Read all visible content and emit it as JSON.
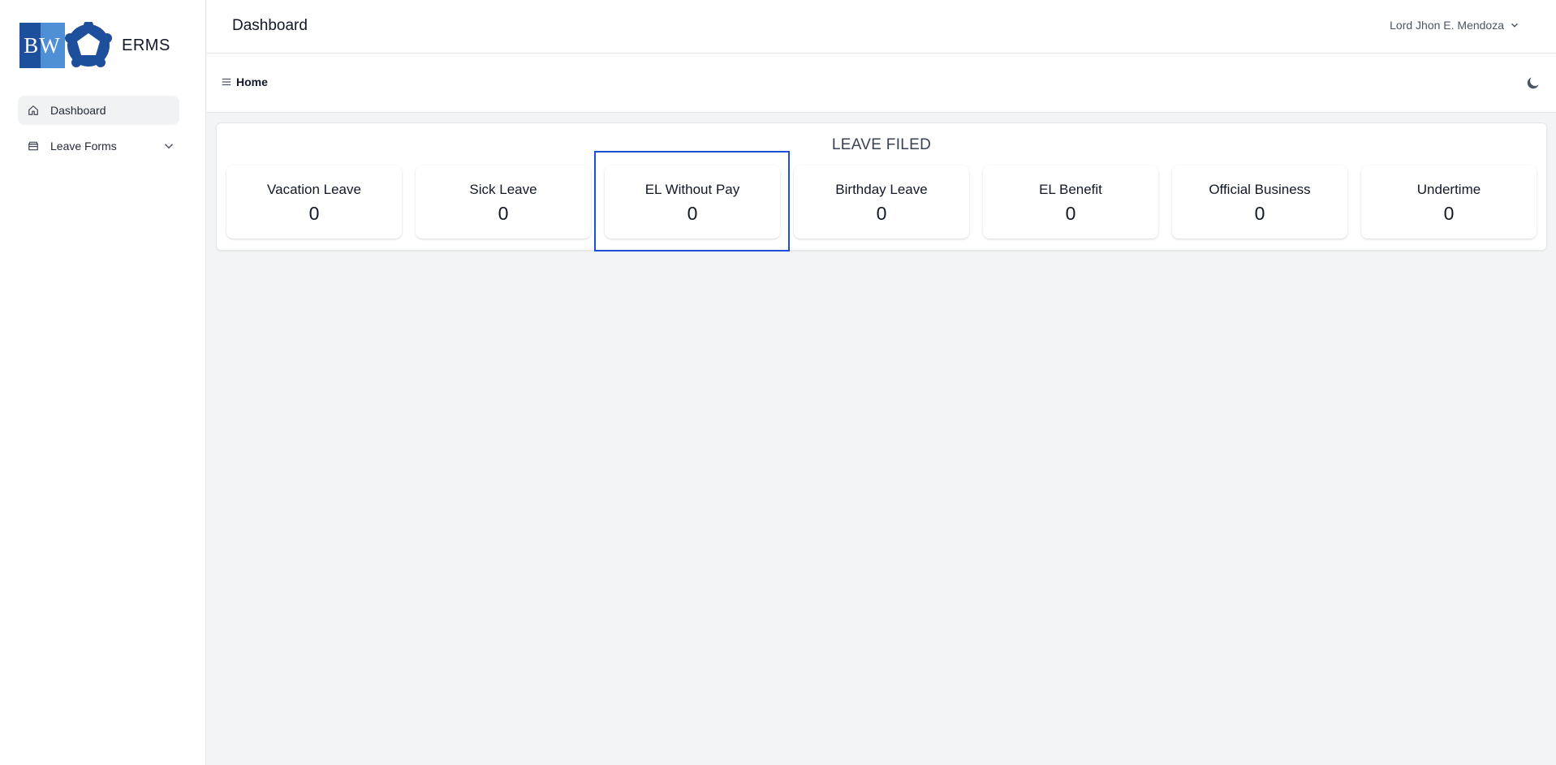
{
  "brand": {
    "logo_text": "BW",
    "name": "ERMS"
  },
  "sidebar": {
    "items": [
      {
        "label": "Dashboard",
        "icon": "home-icon",
        "active": true
      },
      {
        "label": "Leave Forms",
        "icon": "archive-icon",
        "expandable": true
      }
    ]
  },
  "header": {
    "title": "Dashboard",
    "user_name": "Lord Jhon E. Mendoza"
  },
  "toolbar": {
    "breadcrumb": "Home",
    "theme_icon": "moon-icon"
  },
  "leave_panel": {
    "title": "LEAVE FILED",
    "cards": [
      {
        "label": "Vacation Leave",
        "value": "0"
      },
      {
        "label": "Sick Leave",
        "value": "0"
      },
      {
        "label": "EL Without Pay",
        "value": "0"
      },
      {
        "label": "Birthday Leave",
        "value": "0"
      },
      {
        "label": "EL Benefit",
        "value": "0"
      },
      {
        "label": "Official Business",
        "value": "0"
      },
      {
        "label": "Undertime",
        "value": "0"
      }
    ]
  },
  "colors": {
    "logo_dark": "#1e4f9c",
    "logo_light": "#4f8fd6",
    "highlight": "#1d4ed8",
    "background": "#f3f4f6"
  }
}
